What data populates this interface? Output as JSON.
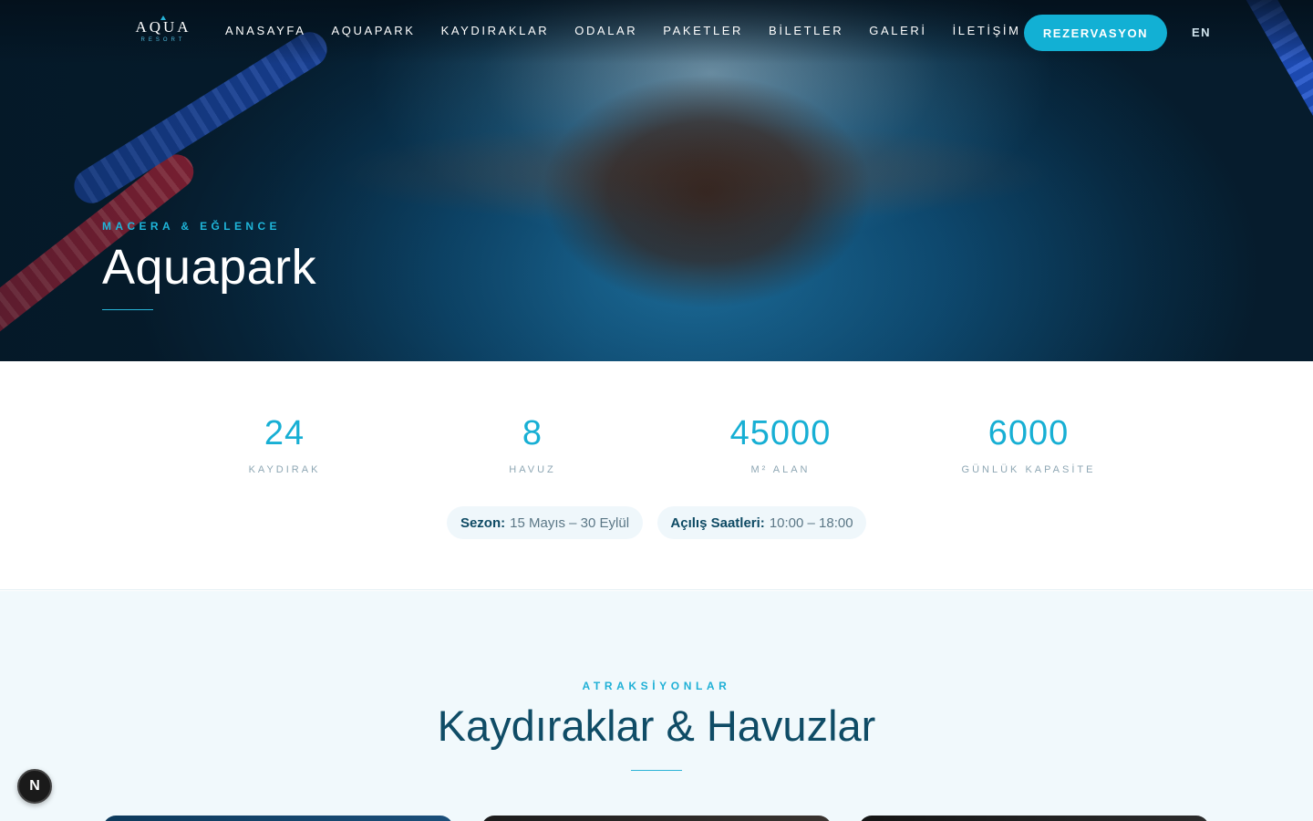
{
  "brand": {
    "name": "AQUA",
    "sub": "RESORT"
  },
  "nav": {
    "items": [
      "ANASAYFA",
      "AQUAPARK",
      "KAYDIRAKLAR",
      "ODALAR",
      "PAKETLER",
      "BİLETLER",
      "GALERİ",
      "İLETİŞİM"
    ],
    "cta": "REZERVASYON",
    "lang": "EN"
  },
  "hero": {
    "kicker": "MACERA & EĞLENCE",
    "title": "Aquapark"
  },
  "stats": [
    {
      "value": "24",
      "label": "KAYDIRAK"
    },
    {
      "value": "8",
      "label": "HAVUZ"
    },
    {
      "value": "45000",
      "label": "M² ALAN"
    },
    {
      "value": "6000",
      "label": "GÜNLÜK KAPASİTE"
    }
  ],
  "info": {
    "season_label": "Sezon:",
    "season_value": "15 Mayıs – 30 Eylül",
    "hours_label": "Açılış Saatleri:",
    "hours_value": "10:00 – 18:00"
  },
  "attractions": {
    "kicker": "ATRAKSİYONLAR",
    "title": "Kaydıraklar & Havuzlar"
  },
  "badge": "N",
  "colors": {
    "accent": "#12b0d4",
    "heading": "#0f4c66",
    "section_bg": "#f1f9fc"
  }
}
